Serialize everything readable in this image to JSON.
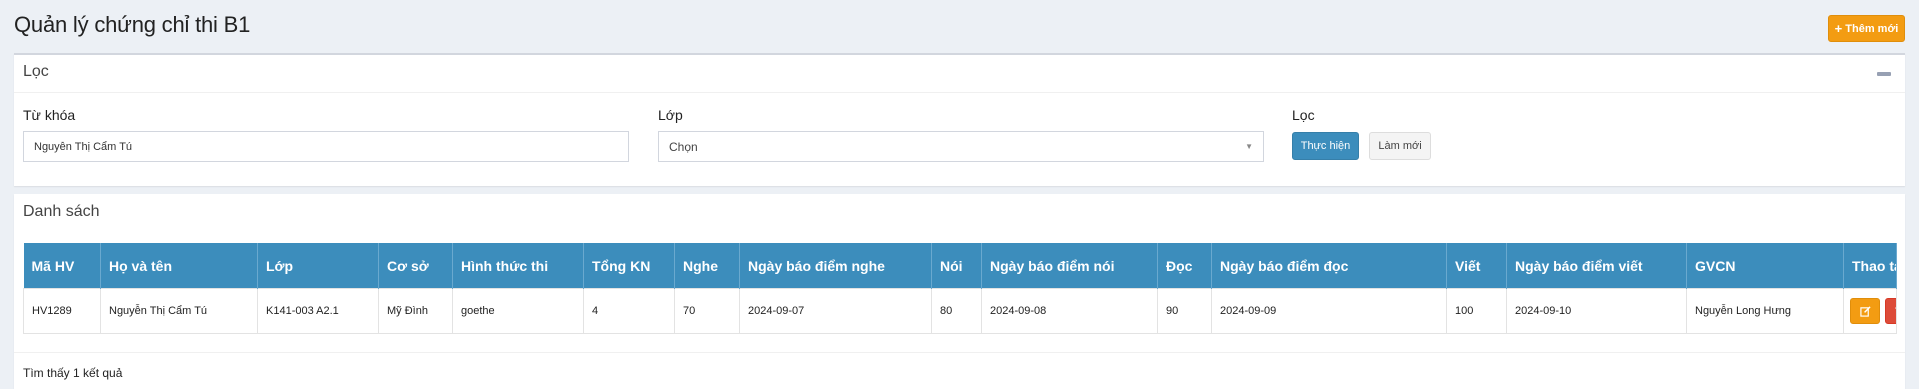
{
  "header": {
    "title": "Quản lý chứng chỉ thi B1",
    "add_button": "Thêm mới"
  },
  "filter": {
    "title": "Lọc",
    "keyword_label": "Từ khóa",
    "keyword_value": "Nguyễn Thị Cẩm Tú",
    "class_label": "Lớp",
    "class_value": "Chọn",
    "action_label": "Lọc",
    "apply_button": "Thực hiện",
    "reset_button": "Làm mới"
  },
  "list": {
    "title": "Danh sách",
    "columns": [
      "Mã HV",
      "Họ và tên",
      "Lớp",
      "Cơ sở",
      "Hình thức thi",
      "Tổng KN",
      "Nghe",
      "Ngày báo điểm nghe",
      "Nói",
      "Ngày báo điểm nói",
      "Đọc",
      "Ngày báo điểm đọc",
      "Viết",
      "Ngày báo điểm viết",
      "GVCN",
      "Thao tác"
    ],
    "rows": [
      [
        "HV1289",
        "Nguyễn Thị Cẩm Tú",
        "K141-003 A2.1",
        "Mỹ Đình",
        "goethe",
        "4",
        "70",
        "2024-09-07",
        "80",
        "2024-09-08",
        "90",
        "2024-09-09",
        "100",
        "2024-09-10",
        "Nguyễn Long Hưng"
      ]
    ],
    "result_text": "Tìm thấy 1 kết quả"
  },
  "icons": {
    "add": "plus-icon",
    "collapse": "minus-icon",
    "dropdown": "caret-down-icon",
    "edit": "edit-icon",
    "delete": "trash-icon"
  },
  "colors": {
    "primary": "#3c8dbc",
    "warning": "#f39c12",
    "danger": "#dd4b39",
    "background": "#ecf0f5"
  }
}
